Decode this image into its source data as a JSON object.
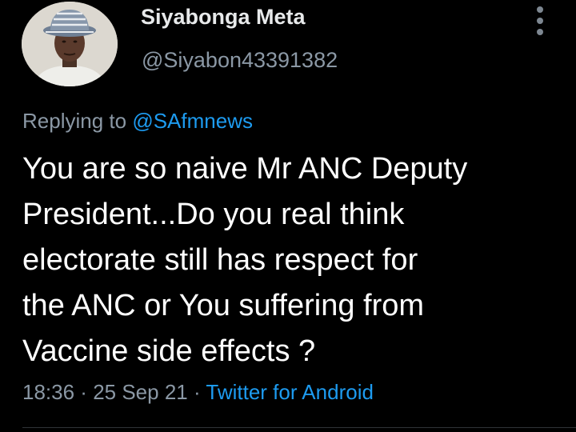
{
  "author": {
    "name": "Siyabonga Meta",
    "handle": "@Siyabon43391382"
  },
  "reply": {
    "prefix": "Replying to ",
    "mention": "@SAfmnews"
  },
  "tweet": {
    "lines": [
      "You are so naive Mr ANC Deputy",
      "President...Do you real think",
      "electorate still has respect for",
      "the ANC or You suffering from",
      "Vaccine side effects ?"
    ]
  },
  "meta": {
    "time": "18:36",
    "separator": " · ",
    "date": "25 Sep 21",
    "source": "Twitter for Android"
  },
  "icons": {
    "more": "more-vertical-icon",
    "avatar": "user-avatar-photo"
  },
  "colors": {
    "background": "#000000",
    "text": "#ffffff",
    "secondary": "#8b98a5",
    "link": "#1d9bf0"
  }
}
